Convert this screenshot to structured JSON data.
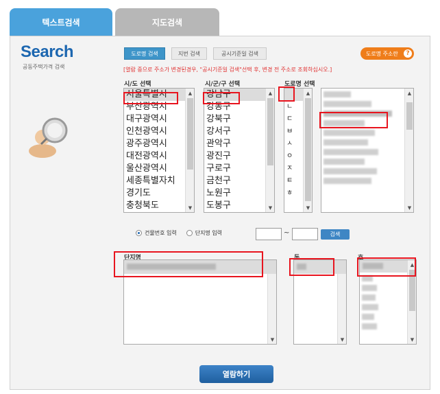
{
  "tabs": [
    {
      "label": "텍스트검색",
      "active": true
    },
    {
      "label": "지도검색",
      "active": false
    }
  ],
  "logo": {
    "title": "Search",
    "subtitle": "공동주택가격 검색"
  },
  "mode_buttons": [
    {
      "label": "도로명 검색",
      "active": true
    },
    {
      "label": "지번 검색",
      "active": false
    },
    {
      "label": "공시기준일 검색",
      "active": false
    }
  ],
  "address_help_button": "도로명 주소란",
  "notice": "[열람 중으로 주소가 변경된경우, \"공시기준일 검색\"선택 후, 변경 전 주소로 조회하십시오.]",
  "columns": {
    "sido": "시/도 선택",
    "sigungu": "시/군/구 선택",
    "road": "도로명 선택"
  },
  "sido_list": [
    "서울특별시",
    "부산광역시",
    "대구광역시",
    "인천광역시",
    "광주광역시",
    "대전광역시",
    "울산광역시",
    "세종특별자치",
    "경기도",
    "충청북도"
  ],
  "sigungu_list": [
    "강남구",
    "강동구",
    "강북구",
    "강서구",
    "관악구",
    "광진구",
    "구로구",
    "금천구",
    "노원구",
    "도봉구"
  ],
  "initial_list": [
    "",
    "ㄴ",
    "ㄷ",
    "ㅂ",
    "ㅅ",
    "ㅇ",
    "ㅈ",
    "ㅌ",
    "ㅎ"
  ],
  "search_options": {
    "building_number": "건물번호 입력",
    "lot_number": "단지명 입력",
    "dash": "~",
    "search_button": "검색"
  },
  "result_labels": {
    "complex": "단지명",
    "dong": "동",
    "ho": "호"
  },
  "open_button": "열람하기",
  "colors": {
    "accent": "#4aa2dc",
    "brand": "#1d67b0",
    "highlight": "#e8141e",
    "help": "#ef7d1a"
  }
}
